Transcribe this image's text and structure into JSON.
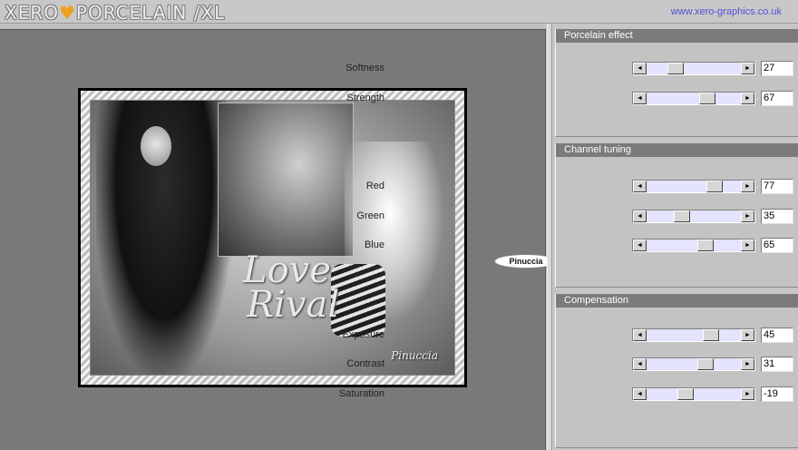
{
  "header": {
    "logo_part1": "XERO",
    "logo_heart": "♥",
    "logo_part2": "PORCELAIN /XL",
    "site_link": "www.xero-graphics.co.uk"
  },
  "preview": {
    "love_text_line1": "Love",
    "love_text_line2": "Rival",
    "signature": "Pinuccia",
    "watermark": "Pinuccia"
  },
  "groups": [
    {
      "title": "Porcelain effect",
      "sliders": [
        {
          "label": "Softness",
          "value": "27",
          "fraction": 0.27
        },
        {
          "label": "Strength",
          "value": "67",
          "fraction": 0.67
        }
      ]
    },
    {
      "title": "Channel tuning",
      "sliders": [
        {
          "label": "Red",
          "value": "77",
          "fraction": 0.77
        },
        {
          "label": "Green",
          "value": "35",
          "fraction": 0.35
        },
        {
          "label": "Blue",
          "value": "65",
          "fraction": 0.65
        }
      ]
    },
    {
      "title": "Compensation",
      "sliders": [
        {
          "label": "Exposure",
          "value": "45",
          "fraction": 0.72
        },
        {
          "label": "Contrast",
          "value": "31",
          "fraction": 0.65
        },
        {
          "label": "Saturation",
          "value": "-19",
          "fraction": 0.4
        }
      ]
    }
  ],
  "colors": {
    "slider_track": "#e4e4ff",
    "group_title_bg": "#7b7b7b",
    "link": "#5050d8",
    "logo_heart": "#f0a020"
  }
}
